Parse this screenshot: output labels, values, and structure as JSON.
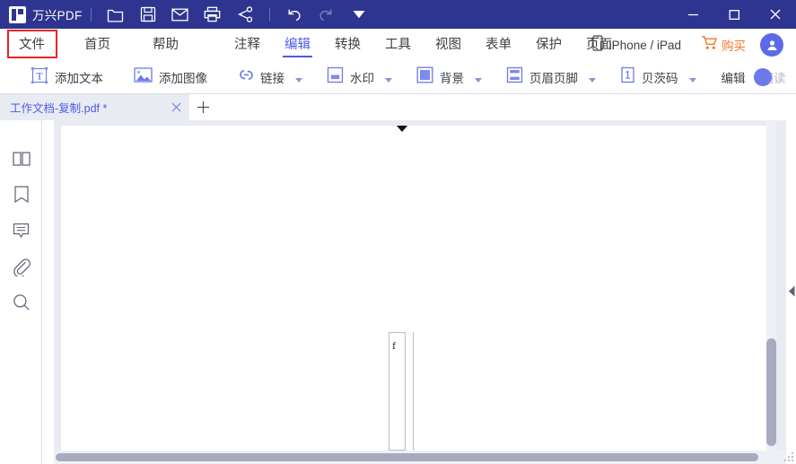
{
  "window": {
    "brand": "万兴PDF",
    "controls": {
      "minimize": "minimize-icon",
      "maximize": "maximize-icon",
      "close": "close-icon"
    },
    "quick_tools": [
      {
        "name": "open-folder-icon",
        "tooltip": "打开"
      },
      {
        "name": "save-icon",
        "tooltip": "保存"
      },
      {
        "name": "mail-icon",
        "tooltip": "邮件"
      },
      {
        "name": "print-icon",
        "tooltip": "打印"
      },
      {
        "name": "share-icon",
        "tooltip": "分享"
      },
      {
        "name": "undo-icon",
        "tooltip": "撤销"
      },
      {
        "name": "redo-icon",
        "tooltip": "重做"
      },
      {
        "name": "more-down-icon",
        "tooltip": "更多"
      }
    ]
  },
  "menubar": {
    "left_items": [
      {
        "label": "文件",
        "active": false,
        "highlighted": true
      },
      {
        "label": "首页",
        "active": false,
        "highlighted": false
      },
      {
        "label": "帮助",
        "active": false,
        "highlighted": false
      }
    ],
    "center_items": [
      {
        "label": "注释",
        "active": false
      },
      {
        "label": "编辑",
        "active": true
      },
      {
        "label": "转换",
        "active": false
      },
      {
        "label": "工具",
        "active": false
      },
      {
        "label": "视图",
        "active": false
      },
      {
        "label": "表单",
        "active": false
      },
      {
        "label": "保护",
        "active": false
      },
      {
        "label": "页面",
        "active": false
      }
    ],
    "ios_label": "iPhone / iPad",
    "ios_icon": "mobile-device-icon",
    "buy_label": "购买",
    "buy_icon": "shopping-cart-icon",
    "avatar_icon": "user-avatar-icon",
    "highlight_color": "#ee2222",
    "active_color": "#4a5ae8",
    "buy_color": "#f4762a"
  },
  "toolbar": {
    "items": [
      {
        "label": "添加文本",
        "icon": "add-text-icon",
        "caret": false
      },
      {
        "label": "添加图像",
        "icon": "add-image-icon",
        "caret": false
      },
      {
        "label": "链接",
        "icon": "link-icon",
        "caret": true
      },
      {
        "label": "水印",
        "icon": "watermark-icon",
        "caret": true
      },
      {
        "label": "背景",
        "icon": "background-icon",
        "caret": true
      },
      {
        "label": "页眉页脚",
        "icon": "header-footer-icon",
        "caret": true
      },
      {
        "label": "贝茨码",
        "icon": "bates-numbering-icon",
        "caret": true
      }
    ],
    "mode_edit_label": "编辑",
    "mode_read_label": "阅读",
    "mode_toggle_state": "edit",
    "settings_icon": "hexagon-settings-icon"
  },
  "tabbar": {
    "tabs": [
      {
        "title": "工作文档-复制.pdf *",
        "active": true,
        "close_icon": "close-icon"
      }
    ],
    "new_tab_icon": "plus-icon"
  },
  "rail": {
    "items": [
      {
        "name": "sidebar-item-thumbnails",
        "icon": "thumbnails-icon"
      },
      {
        "name": "sidebar-item-bookmarks",
        "icon": "bookmark-icon"
      },
      {
        "name": "sidebar-item-comments",
        "icon": "comment-icon"
      },
      {
        "name": "sidebar-item-attachments",
        "icon": "paperclip-icon"
      },
      {
        "name": "sidebar-item-search",
        "icon": "search-icon"
      }
    ],
    "collapse_icon": "chevron-right-icon"
  },
  "viewer": {
    "page_marker_icon": "page-position-marker-icon",
    "textbox_content": "f",
    "vscroll_collapse_icon": "chevron-left-icon",
    "resize_grip_icon": "resize-grip-icon"
  }
}
